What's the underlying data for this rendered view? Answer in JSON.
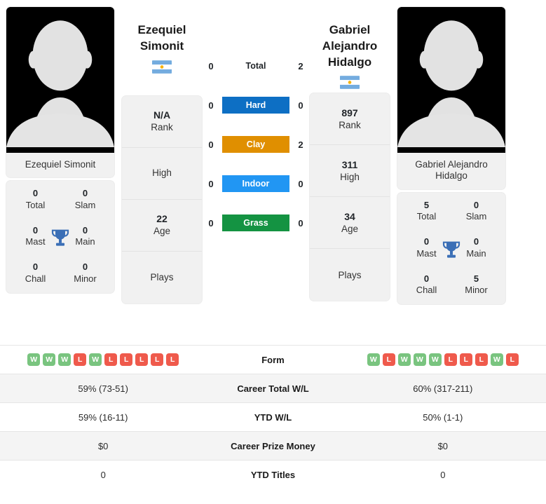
{
  "players": {
    "left": {
      "name_lines": [
        "Ezequiel",
        "Simonit"
      ],
      "photo_caption": "Ezequiel Simonit",
      "flag": "argentina-flag",
      "info": [
        {
          "value": "N/A",
          "label": "Rank"
        },
        {
          "value": "",
          "label": "High"
        },
        {
          "value": "22",
          "label": "Age"
        },
        {
          "value": "",
          "label": "Plays"
        }
      ],
      "titles": [
        {
          "value": "0",
          "label": "Total"
        },
        {
          "value": "0",
          "label": "Slam"
        },
        {
          "value": "0",
          "label": "Mast"
        },
        {
          "value": "0",
          "label": "Main"
        },
        {
          "value": "0",
          "label": "Chall"
        },
        {
          "value": "0",
          "label": "Minor"
        }
      ],
      "surface_values": {
        "total": "0",
        "hard": "0",
        "clay": "0",
        "indoor": "0",
        "grass": "0"
      },
      "form": [
        "W",
        "W",
        "W",
        "L",
        "W",
        "L",
        "L",
        "L",
        "L",
        "L"
      ],
      "career_wl": "59% (73-51)",
      "ytd_wl": "59% (16-11)",
      "career_prize": "$0",
      "ytd_titles": "0"
    },
    "right": {
      "name_lines": [
        "Gabriel",
        "Alejandro",
        "Hidalgo"
      ],
      "photo_caption": "Gabriel Alejandro Hidalgo",
      "flag": "argentina-flag",
      "info": [
        {
          "value": "897",
          "label": "Rank"
        },
        {
          "value": "311",
          "label": "High"
        },
        {
          "value": "34",
          "label": "Age"
        },
        {
          "value": "",
          "label": "Plays"
        }
      ],
      "titles": [
        {
          "value": "5",
          "label": "Total"
        },
        {
          "value": "0",
          "label": "Slam"
        },
        {
          "value": "0",
          "label": "Mast"
        },
        {
          "value": "0",
          "label": "Main"
        },
        {
          "value": "0",
          "label": "Chall"
        },
        {
          "value": "5",
          "label": "Minor"
        }
      ],
      "surface_values": {
        "total": "2",
        "hard": "0",
        "clay": "2",
        "indoor": "0",
        "grass": "0"
      },
      "form": [
        "W",
        "L",
        "W",
        "W",
        "W",
        "L",
        "L",
        "L",
        "W",
        "L"
      ],
      "career_wl": "60% (317-211)",
      "ytd_wl": "50% (1-1)",
      "career_prize": "$0",
      "ytd_titles": "0"
    }
  },
  "surfaces": [
    {
      "key": "total",
      "label": "Total",
      "color": "transparent"
    },
    {
      "key": "hard",
      "label": "Hard",
      "color": "#0d6fc4"
    },
    {
      "key": "clay",
      "label": "Clay",
      "color": "#e08f00"
    },
    {
      "key": "indoor",
      "label": "Indoor",
      "color": "#2196f3"
    },
    {
      "key": "grass",
      "label": "Grass",
      "color": "#149342"
    }
  ],
  "table_rows": [
    {
      "label": "Form",
      "type": "form"
    },
    {
      "label": "Career Total W/L",
      "type": "text",
      "field": "career_wl"
    },
    {
      "label": "YTD W/L",
      "type": "text",
      "field": "ytd_wl"
    },
    {
      "label": "Career Prize Money",
      "type": "text",
      "field": "career_prize"
    },
    {
      "label": "YTD Titles",
      "type": "text",
      "field": "ytd_titles"
    }
  ],
  "colors": {
    "hard": "#0d6fc4",
    "clay": "#e08f00",
    "indoor": "#2196f3",
    "grass": "#149342",
    "win": "#79c47f",
    "loss": "#ef5a4c",
    "trophy": "#3b6fb6",
    "card_bg": "#f1f1f1"
  },
  "icons": {
    "trophy": "trophy-icon",
    "avatar": "avatar-silhouette-icon",
    "flag": "argentina-flag-icon"
  }
}
